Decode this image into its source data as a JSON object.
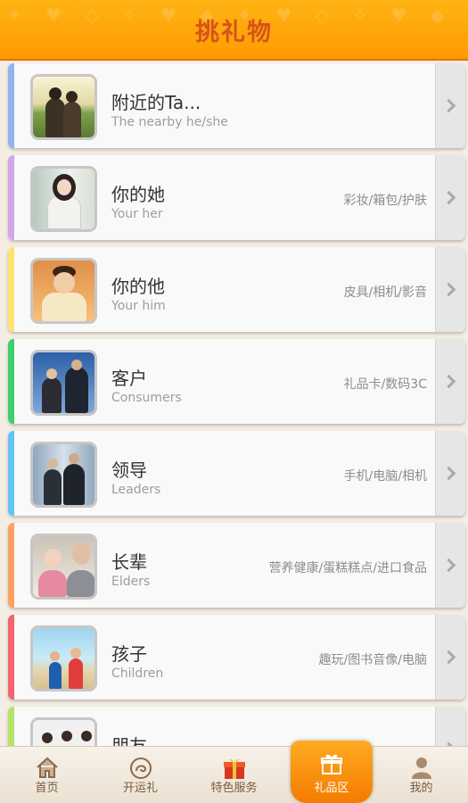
{
  "header": {
    "title": "挑礼物",
    "pattern": "✦ ♥ ◇ ✧ ♥ ◆ ✦ ♥ ◇ ✧ ♥ ◆ ✦ ♥ ◇"
  },
  "items": [
    {
      "title": "附近的Ta...",
      "subtitle": "The nearby he/she",
      "tags": "",
      "accent": "#8fb4f0"
    },
    {
      "title": "你的她",
      "subtitle": "Your her",
      "tags": "彩妆/箱包/护肤",
      "accent": "#d2a6ea"
    },
    {
      "title": "你的他",
      "subtitle": "Your him",
      "tags": "皮具/相机/影音",
      "accent": "#ffe172"
    },
    {
      "title": "客户",
      "subtitle": "Consumers",
      "tags": "礼品卡/数码3C",
      "accent": "#3ccf6b"
    },
    {
      "title": "领导",
      "subtitle": "Leaders",
      "tags": "手机/电脑/相机",
      "accent": "#63c3f4"
    },
    {
      "title": "长辈",
      "subtitle": "Elders",
      "tags": "营养健康/蛋糕糕点/进口食品",
      "accent": "#ffa160"
    },
    {
      "title": "孩子",
      "subtitle": "Children",
      "tags": "趣玩/图书音像/电脑",
      "accent": "#f76271"
    },
    {
      "title": "朋友",
      "subtitle": "",
      "tags": "",
      "accent": "#b4e368"
    }
  ],
  "nav": {
    "home": "首页",
    "fortune": "开运礼",
    "special": "特色服务",
    "gift": "礼品区",
    "mine": "我的"
  }
}
